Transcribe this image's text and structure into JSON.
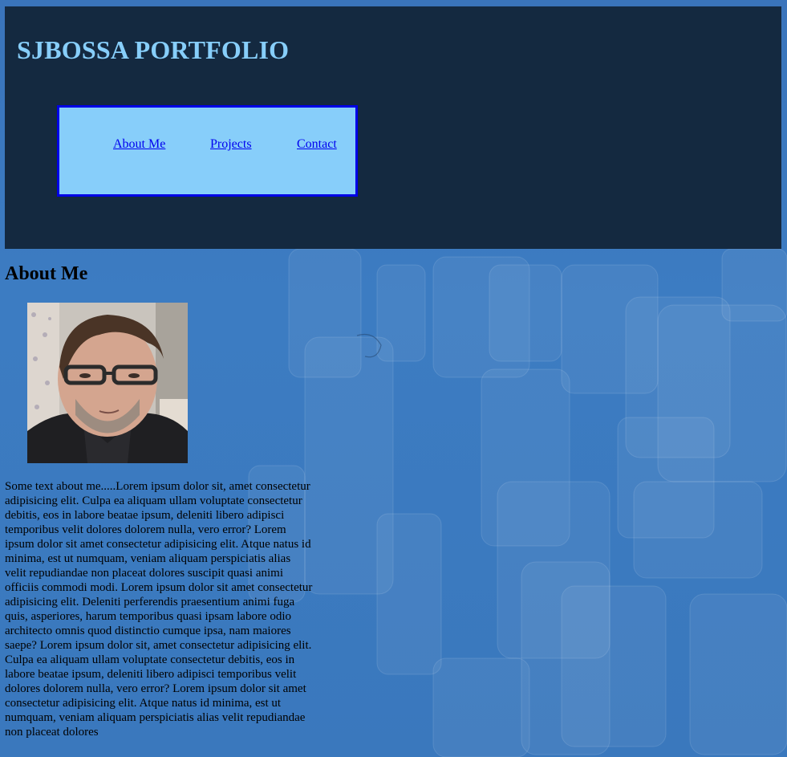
{
  "header": {
    "title": "SJBOSSA PORTFOLIO"
  },
  "nav": {
    "items": [
      {
        "label": "About Me"
      },
      {
        "label": "Projects"
      },
      {
        "label": "Contact"
      }
    ]
  },
  "about": {
    "heading": "About Me",
    "photo_alt": "portrait-photo",
    "text": "Some text about me.....Lorem ipsum dolor sit, amet consectetur adipisicing elit. Culpa ea aliquam ullam voluptate consectetur debitis, eos in labore beatae ipsum, deleniti libero adipisci temporibus velit dolores dolorem nulla, vero error? Lorem ipsum dolor sit amet consectetur adipisicing elit. Atque natus id minima, est ut numquam, veniam aliquam perspiciatis alias velit repudiandae non placeat dolores suscipit quasi animi officiis commodi modi. Lorem ipsum dolor sit amet consectetur adipisicing elit. Deleniti perferendis praesentium animi fuga quis, asperiores, harum temporibus quasi ipsam labore odio architecto omnis quod distinctio cumque ipsa, nam maiores saepe? Lorem ipsum dolor sit, amet consectetur adipisicing elit. Culpa ea aliquam ullam voluptate consectetur debitis, eos in labore beatae ipsum, deleniti libero adipisci temporibus velit dolores dolorem nulla, vero error? Lorem ipsum dolor sit amet consectetur adipisicing elit. Atque natus id minima, est ut numquam, veniam aliquam perspiciatis alias velit repudiandae non placeat dolores"
  },
  "colors": {
    "header_bg": "#142940",
    "title": "#87cefa",
    "nav_bg": "#87cefa",
    "nav_border": "#0000e6",
    "link": "#0000ee",
    "page_bg": "#3a78be"
  }
}
